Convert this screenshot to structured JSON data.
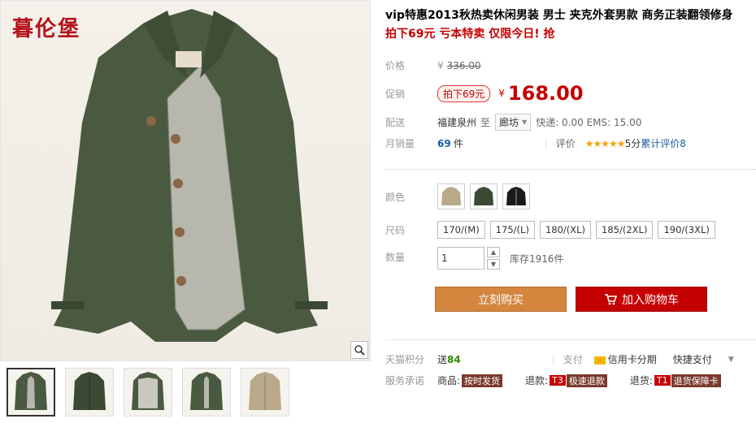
{
  "gallery": {
    "logo": "暮伦堡",
    "thumbnails": [
      "军绿色",
      "墨绿",
      "内里格纹",
      "军绿款",
      "卡其色"
    ]
  },
  "product": {
    "title": "vip特惠2013秋热卖休闲男装 男士 夹克外套男款 商务正装翻领修身",
    "subtitle": "拍下69元 亏本特卖 仅限今日! 抢"
  },
  "price": {
    "label": "价格",
    "currency": "¥",
    "original": "336.00"
  },
  "promo": {
    "label": "促销",
    "tag": "拍下69元",
    "currency": "¥",
    "price": "168.00"
  },
  "shipping": {
    "label": "配送",
    "origin": "福建泉州",
    "to": "至",
    "destination": "廊坊",
    "fee": "快递: 0.00 EMS: 15.00"
  },
  "sales": {
    "label": "月销量",
    "count": "69",
    "unit": "件",
    "rating_label": "评价",
    "stars": "★★★★★",
    "score": "5分",
    "reviews_link": "累计评价8"
  },
  "color": {
    "label": "颜色",
    "options": [
      "卡其",
      "军绿",
      "黑色"
    ]
  },
  "size": {
    "label": "尺码",
    "options": [
      "170/(M)",
      "175/(L)",
      "180/(XL)",
      "185/(2XL)",
      "190/(3XL)"
    ]
  },
  "quantity": {
    "label": "数量",
    "value": "1",
    "stock": "库存1916件"
  },
  "actions": {
    "buy_now": "立刻购买",
    "add_cart": "加入购物车"
  },
  "points": {
    "label": "天猫积分",
    "prefix": "送",
    "value": "84",
    "pay_label": "支付",
    "credit": "信用卡分期",
    "quick_pay": "快捷支付"
  },
  "services": {
    "label": "服务承诺",
    "goods_label": "商品:",
    "goods_text": "按时发货",
    "return_label": "退款:",
    "return_badge": "T3",
    "return_text": "极速退款",
    "exchange_label": "退货:",
    "exchange_badge": "T1",
    "exchange_text": "退货保障卡"
  },
  "colors": {
    "accent_red": "#c40000",
    "buy_orange": "#d4863f",
    "jacket_green": "#4a5a40"
  }
}
